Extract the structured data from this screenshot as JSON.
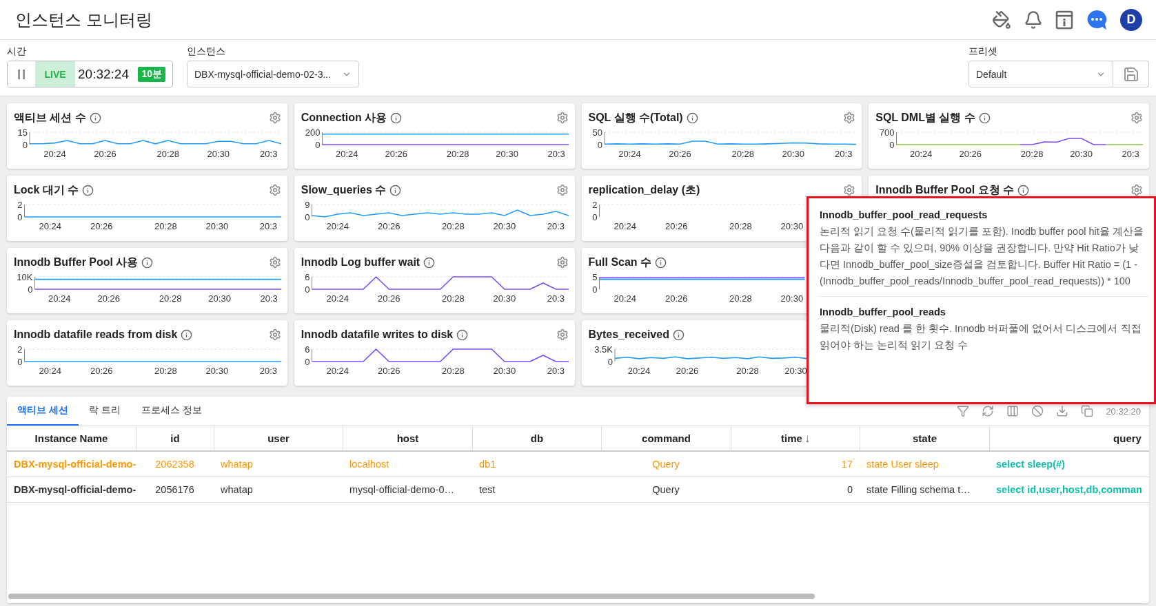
{
  "page_title": "인스턴스 모니터링",
  "header_icons": {
    "avatar": "D"
  },
  "filters": {
    "time_label": "시간",
    "live": {
      "paused": false,
      "label": "LIVE",
      "time": "20:32:24",
      "range": "10분"
    },
    "instance_label": "인스턴스",
    "instance_value": "DBX-mysql-official-demo-02-3...",
    "preset_label": "프리셋",
    "preset_value": "Default"
  },
  "card_rows": [
    [
      {
        "title": "액티브 세션 수",
        "info": true,
        "chart_data": {
          "type": "line",
          "ylim": [
            0,
            15
          ],
          "yticks": [
            0,
            15
          ],
          "categories": [
            null,
            null,
            "20:24",
            null,
            null,
            null,
            "20:26",
            null,
            null,
            null,
            null,
            "20:28",
            null,
            null,
            null,
            "20:30",
            null,
            null,
            null,
            "20:3",
            null
          ],
          "series": [
            {
              "color": "#1e9bff",
              "values": [
                1,
                1,
                2,
                5,
                1,
                1,
                5,
                1,
                1,
                5,
                1,
                5,
                1,
                1,
                1,
                4,
                4,
                1,
                1,
                5,
                1
              ]
            }
          ]
        }
      },
      {
        "title": "Connection 사용",
        "info": true,
        "chart_data": {
          "type": "line",
          "ylim": [
            0,
            200
          ],
          "yticks": [
            0,
            200
          ],
          "categories": [
            null,
            null,
            "20:24",
            null,
            null,
            null,
            "20:26",
            null,
            null,
            null,
            null,
            "20:28",
            null,
            null,
            null,
            "20:30",
            null,
            null,
            null,
            "20:3",
            null
          ],
          "series": [
            {
              "color": "#1e9bff",
              "values": [
                170,
                170,
                170,
                170,
                170,
                170,
                170,
                170,
                170,
                170,
                170,
                170,
                170,
                170,
                170,
                170,
                170,
                170,
                170,
                170,
                170
              ]
            },
            {
              "color": "#7c4dff",
              "values": [
                0,
                0,
                0,
                0,
                0,
                0,
                0,
                0,
                0,
                0,
                0,
                0,
                0,
                0,
                0,
                0,
                0,
                0,
                0,
                0,
                0
              ]
            }
          ]
        }
      },
      {
        "title": "SQL 실행 수(Total)",
        "info": true,
        "chart_data": {
          "type": "line",
          "ylim": [
            0,
            50
          ],
          "yticks": [
            0,
            50
          ],
          "categories": [
            null,
            null,
            "20:24",
            null,
            null,
            null,
            "20:26",
            null,
            null,
            null,
            null,
            "20:28",
            null,
            null,
            null,
            "20:30",
            null,
            null,
            null,
            "20:3",
            null
          ],
          "series": [
            {
              "color": "#1e9bff",
              "values": [
                2,
                3,
                2,
                3,
                2,
                3,
                2,
                14,
                14,
                2,
                3,
                2,
                2,
                3,
                5,
                7,
                6,
                3,
                2,
                2,
                1
              ]
            }
          ]
        }
      },
      {
        "title": "SQL DML별 실행 수",
        "info": true,
        "chart_data": {
          "type": "line",
          "ylim": [
            0,
            700
          ],
          "yticks": [
            0,
            700
          ],
          "categories": [
            null,
            null,
            "20:24",
            null,
            null,
            null,
            "20:26",
            null,
            null,
            null,
            null,
            "20:28",
            null,
            null,
            null,
            "20:30",
            null,
            null,
            null,
            "20:3",
            null
          ],
          "series": [
            {
              "color": "#8bc34a",
              "values": [
                0,
                0,
                0,
                0,
                0,
                0,
                0,
                0,
                0,
                0,
                0,
                null,
                null,
                null,
                null,
                null,
                null,
                0,
                0,
                0,
                0
              ]
            },
            {
              "color": "#7c4dff",
              "values": [
                null,
                null,
                null,
                null,
                null,
                null,
                null,
                null,
                null,
                null,
                0,
                0,
                150,
                140,
                350,
                350,
                0,
                0,
                null,
                null,
                null
              ]
            }
          ]
        }
      }
    ],
    [
      {
        "title": "Lock 대기 수",
        "info": true,
        "chart_data": {
          "type": "line",
          "ylim": [
            0,
            2
          ],
          "yticks": [
            0,
            2
          ],
          "categories": [
            null,
            null,
            "20:24",
            null,
            null,
            null,
            "20:26",
            null,
            null,
            null,
            null,
            "20:28",
            null,
            null,
            null,
            "20:30",
            null,
            null,
            null,
            "20:3",
            null
          ],
          "series": [
            {
              "color": "#1e9bff",
              "values": [
                0,
                0,
                0,
                0,
                0,
                0,
                0,
                0,
                0,
                0,
                0,
                0,
                0,
                0,
                0,
                0,
                0,
                0,
                0,
                0,
                0
              ]
            }
          ]
        }
      },
      {
        "title": "Slow_queries 수",
        "info": true,
        "chart_data": {
          "type": "line",
          "ylim": [
            0,
            9
          ],
          "yticks": [
            0,
            9
          ],
          "categories": [
            null,
            null,
            "20:24",
            null,
            null,
            null,
            "20:26",
            null,
            null,
            null,
            null,
            "20:28",
            null,
            null,
            null,
            "20:30",
            null,
            null,
            null,
            "20:3",
            null
          ],
          "series": [
            {
              "color": "#1e9bff",
              "values": [
                1,
                0,
                2,
                3,
                1,
                2,
                3,
                1,
                2,
                3,
                2,
                3,
                2,
                2,
                3,
                1,
                5,
                1,
                2,
                4,
                1
              ]
            }
          ]
        }
      },
      {
        "title": "replication_delay (초)",
        "info": false,
        "chart_data": {
          "type": "line",
          "ylim": [
            0,
            2
          ],
          "yticks": [
            0,
            2
          ],
          "categories": [
            null,
            null,
            "20:24",
            null,
            null,
            null,
            "20:26",
            null,
            null,
            null,
            null,
            "20:28",
            null,
            null,
            null,
            "20:30",
            null,
            null,
            null,
            null,
            null
          ]
        }
      },
      {
        "title": "Innodb Buffer Pool 요청 수",
        "info": true
      }
    ],
    [
      {
        "title": "Innodb Buffer Pool 사용",
        "info": true,
        "chart_data": {
          "type": "line",
          "ylim": [
            0,
            10000
          ],
          "yticks": [
            0,
            {
              "value": 10000,
              "label": "10K"
            }
          ],
          "categories": [
            null,
            null,
            "20:24",
            null,
            null,
            null,
            "20:26",
            null,
            null,
            null,
            null,
            "20:28",
            null,
            null,
            null,
            "20:30",
            null,
            null,
            null,
            "20:3",
            null
          ],
          "series": [
            {
              "color": "#1e9bff",
              "values": [
                8000,
                8000,
                8000,
                8000,
                8000,
                8000,
                8000,
                8000,
                8000,
                8000,
                8000,
                8000,
                8000,
                8000,
                8000,
                8000,
                8000,
                8000,
                8000,
                8000,
                8000
              ]
            },
            {
              "color": "#7c4dff",
              "values": [
                0,
                0,
                0,
                0,
                0,
                0,
                0,
                0,
                0,
                0,
                0,
                0,
                0,
                0,
                0,
                0,
                0,
                0,
                0,
                0,
                0
              ]
            }
          ]
        }
      },
      {
        "title": "Innodb Log buffer wait",
        "info": true,
        "chart_data": {
          "type": "line",
          "ylim": [
            0,
            6
          ],
          "yticks": [
            0,
            6
          ],
          "categories": [
            null,
            null,
            "20:24",
            null,
            null,
            null,
            "20:26",
            null,
            null,
            null,
            null,
            "20:28",
            null,
            null,
            null,
            "20:30",
            null,
            null,
            null,
            "20:3",
            null
          ],
          "series": [
            {
              "color": "#7c4dff",
              "values": [
                0,
                0,
                0,
                0,
                0,
                6,
                0,
                0,
                0,
                0,
                0,
                6,
                6,
                6,
                6,
                0,
                0,
                0,
                3,
                0,
                0
              ]
            }
          ]
        }
      },
      {
        "title": "Full Scan 수",
        "info": true,
        "settings": false,
        "chart_data": {
          "type": "line",
          "ylim": [
            0,
            5
          ],
          "yticks": [
            0,
            5
          ],
          "categories": [
            null,
            null,
            "20:24",
            null,
            null,
            null,
            "20:26",
            null,
            null,
            null,
            null,
            "20:28",
            null,
            null,
            null,
            "20:30",
            null,
            null,
            null,
            null,
            null
          ],
          "series": [
            {
              "color": "#1e9bff",
              "values": [
                4,
                4,
                4,
                4,
                4,
                4,
                4,
                4,
                4,
                4,
                4,
                4,
                4,
                4,
                4,
                4,
                4,
                null,
                null,
                null,
                null
              ]
            },
            {
              "color": "#7c4dff",
              "values": [
                4.6,
                4.6,
                4.6,
                4.6,
                4.6,
                4.6,
                4.6,
                4.6,
                4.6,
                4.6,
                4.6,
                4.6,
                4.6,
                4.6,
                4.6,
                4.6,
                4.6,
                null,
                null,
                null,
                null
              ]
            }
          ]
        }
      }
    ],
    [
      {
        "title": "Innodb datafile reads from disk",
        "info": true,
        "chart_data": {
          "type": "line",
          "ylim": [
            0,
            2
          ],
          "yticks": [
            0,
            2
          ],
          "categories": [
            null,
            null,
            "20:24",
            null,
            null,
            null,
            "20:26",
            null,
            null,
            null,
            null,
            "20:28",
            null,
            null,
            null,
            "20:30",
            null,
            null,
            null,
            "20:3",
            null
          ],
          "series": [
            {
              "color": "#1e9bff",
              "values": [
                0,
                0,
                0,
                0,
                0,
                0,
                0,
                0,
                0,
                0,
                0,
                0,
                0,
                0,
                0,
                0,
                0,
                0,
                0,
                0,
                0
              ]
            }
          ]
        }
      },
      {
        "title": "Innodb datafile writes to disk",
        "info": true,
        "chart_data": {
          "type": "line",
          "ylim": [
            0,
            6
          ],
          "yticks": [
            0,
            6
          ],
          "categories": [
            null,
            null,
            "20:24",
            null,
            null,
            null,
            "20:26",
            null,
            null,
            null,
            null,
            "20:28",
            null,
            null,
            null,
            "20:30",
            null,
            null,
            null,
            "20:3",
            null
          ],
          "series": [
            {
              "color": "#7c4dff",
              "values": [
                0,
                0,
                0,
                0,
                0,
                6,
                0,
                0,
                0,
                0,
                0,
                6,
                6,
                6,
                6,
                0,
                0,
                0,
                3,
                0,
                0
              ]
            }
          ]
        }
      },
      {
        "title": "Bytes_received",
        "info": true,
        "settings": false,
        "chart_data": {
          "type": "line",
          "ylim": [
            0,
            3500
          ],
          "yticks": [
            0,
            {
              "value": 3500,
              "label": "3.5K"
            }
          ],
          "categories": [
            null,
            null,
            "20:24",
            null,
            null,
            null,
            "20:26",
            null,
            null,
            null,
            null,
            "20:28",
            null,
            null,
            null,
            "20:30",
            null,
            null,
            null,
            null,
            null
          ],
          "series": [
            {
              "color": "#1e9bff",
              "values": [
                900,
                1200,
                800,
                1100,
                900,
                1300,
                800,
                1000,
                1200,
                900,
                1100,
                800,
                1300,
                900,
                1000,
                1200,
                800,
                null,
                null,
                null,
                null
              ]
            }
          ]
        }
      }
    ]
  ],
  "tooltip": {
    "sections": [
      {
        "title": "Innodb_buffer_pool_read_requests",
        "body": "논리적 읽기 요청 수(물리적 읽기를 포함). Inodb buffer pool hit율 계산을 다음과 같이 할 수 있으며, 90% 이상을 권장합니다. 만약 Hit Ratio가 낮다면 Innodb_buffer_pool_size증설을 검토합니다. Buffer Hit Ratio = (1 - (Innodb_buffer_pool_reads/Innodb_buffer_pool_read_requests)) * 100"
      },
      {
        "title": "Innodb_buffer_pool_reads",
        "body": "물리적(Disk) read 를 한 횟수. Innodb 버퍼풀에 없어서 디스크에서 직접 읽어야 하는 논리적 읽기 요청 수"
      }
    ]
  },
  "bottom_tabs": [
    {
      "label": "액티브 세션",
      "selected": true
    },
    {
      "label": "락 트리",
      "selected": false
    },
    {
      "label": "프로세스 정보",
      "selected": false
    }
  ],
  "toolbar_time": "20:32:20",
  "table": {
    "columns": [
      {
        "label": "Instance Name"
      },
      {
        "label": "id"
      },
      {
        "label": "user"
      },
      {
        "label": "host"
      },
      {
        "label": "db"
      },
      {
        "label": "command"
      },
      {
        "label": "time",
        "sort_arrow": "↓"
      },
      {
        "label": "state"
      },
      {
        "label": "query"
      }
    ],
    "rows": [
      {
        "highlighted": true,
        "cells": [
          "DBX-mysql-official-demo-",
          "2062358",
          "whatap",
          "localhost",
          "db1",
          "Query",
          "17",
          "state User sleep",
          "select sleep(#)"
        ]
      },
      {
        "highlighted": false,
        "cells": [
          "DBX-mysql-official-demo-",
          "2056176",
          "whatap",
          "mysql-official-demo-0…",
          "test",
          "Query",
          "0",
          "state Filling schema t…",
          "select id,user,host,db,comman"
        ]
      }
    ]
  }
}
